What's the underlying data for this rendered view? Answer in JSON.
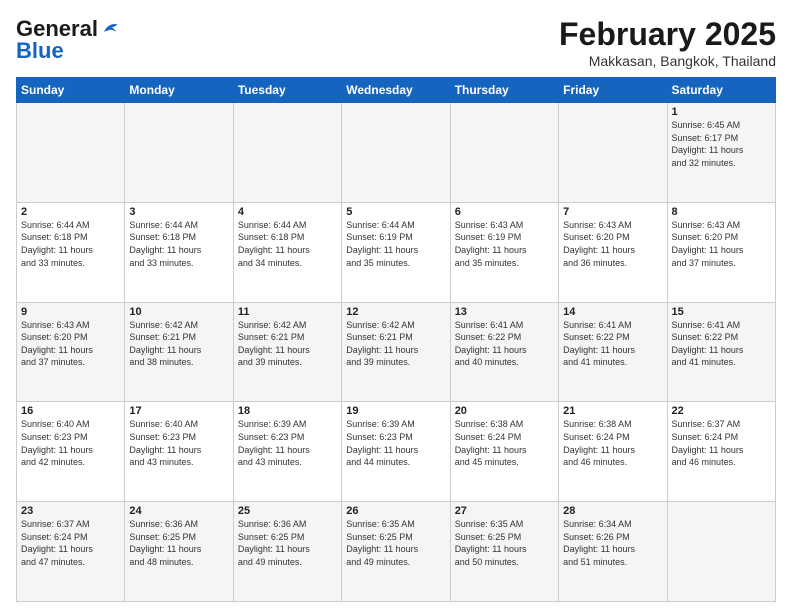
{
  "logo": {
    "line1": "General",
    "line2": "Blue"
  },
  "title": "February 2025",
  "location": "Makkasan, Bangkok, Thailand",
  "days_of_week": [
    "Sunday",
    "Monday",
    "Tuesday",
    "Wednesday",
    "Thursday",
    "Friday",
    "Saturday"
  ],
  "weeks": [
    [
      {
        "day": "",
        "info": ""
      },
      {
        "day": "",
        "info": ""
      },
      {
        "day": "",
        "info": ""
      },
      {
        "day": "",
        "info": ""
      },
      {
        "day": "",
        "info": ""
      },
      {
        "day": "",
        "info": ""
      },
      {
        "day": "1",
        "info": "Sunrise: 6:45 AM\nSunset: 6:17 PM\nDaylight: 11 hours\nand 32 minutes."
      }
    ],
    [
      {
        "day": "2",
        "info": "Sunrise: 6:44 AM\nSunset: 6:18 PM\nDaylight: 11 hours\nand 33 minutes."
      },
      {
        "day": "3",
        "info": "Sunrise: 6:44 AM\nSunset: 6:18 PM\nDaylight: 11 hours\nand 33 minutes."
      },
      {
        "day": "4",
        "info": "Sunrise: 6:44 AM\nSunset: 6:18 PM\nDaylight: 11 hours\nand 34 minutes."
      },
      {
        "day": "5",
        "info": "Sunrise: 6:44 AM\nSunset: 6:19 PM\nDaylight: 11 hours\nand 35 minutes."
      },
      {
        "day": "6",
        "info": "Sunrise: 6:43 AM\nSunset: 6:19 PM\nDaylight: 11 hours\nand 35 minutes."
      },
      {
        "day": "7",
        "info": "Sunrise: 6:43 AM\nSunset: 6:20 PM\nDaylight: 11 hours\nand 36 minutes."
      },
      {
        "day": "8",
        "info": "Sunrise: 6:43 AM\nSunset: 6:20 PM\nDaylight: 11 hours\nand 37 minutes."
      }
    ],
    [
      {
        "day": "9",
        "info": "Sunrise: 6:43 AM\nSunset: 6:20 PM\nDaylight: 11 hours\nand 37 minutes."
      },
      {
        "day": "10",
        "info": "Sunrise: 6:42 AM\nSunset: 6:21 PM\nDaylight: 11 hours\nand 38 minutes."
      },
      {
        "day": "11",
        "info": "Sunrise: 6:42 AM\nSunset: 6:21 PM\nDaylight: 11 hours\nand 39 minutes."
      },
      {
        "day": "12",
        "info": "Sunrise: 6:42 AM\nSunset: 6:21 PM\nDaylight: 11 hours\nand 39 minutes."
      },
      {
        "day": "13",
        "info": "Sunrise: 6:41 AM\nSunset: 6:22 PM\nDaylight: 11 hours\nand 40 minutes."
      },
      {
        "day": "14",
        "info": "Sunrise: 6:41 AM\nSunset: 6:22 PM\nDaylight: 11 hours\nand 41 minutes."
      },
      {
        "day": "15",
        "info": "Sunrise: 6:41 AM\nSunset: 6:22 PM\nDaylight: 11 hours\nand 41 minutes."
      }
    ],
    [
      {
        "day": "16",
        "info": "Sunrise: 6:40 AM\nSunset: 6:23 PM\nDaylight: 11 hours\nand 42 minutes."
      },
      {
        "day": "17",
        "info": "Sunrise: 6:40 AM\nSunset: 6:23 PM\nDaylight: 11 hours\nand 43 minutes."
      },
      {
        "day": "18",
        "info": "Sunrise: 6:39 AM\nSunset: 6:23 PM\nDaylight: 11 hours\nand 43 minutes."
      },
      {
        "day": "19",
        "info": "Sunrise: 6:39 AM\nSunset: 6:23 PM\nDaylight: 11 hours\nand 44 minutes."
      },
      {
        "day": "20",
        "info": "Sunrise: 6:38 AM\nSunset: 6:24 PM\nDaylight: 11 hours\nand 45 minutes."
      },
      {
        "day": "21",
        "info": "Sunrise: 6:38 AM\nSunset: 6:24 PM\nDaylight: 11 hours\nand 46 minutes."
      },
      {
        "day": "22",
        "info": "Sunrise: 6:37 AM\nSunset: 6:24 PM\nDaylight: 11 hours\nand 46 minutes."
      }
    ],
    [
      {
        "day": "23",
        "info": "Sunrise: 6:37 AM\nSunset: 6:24 PM\nDaylight: 11 hours\nand 47 minutes."
      },
      {
        "day": "24",
        "info": "Sunrise: 6:36 AM\nSunset: 6:25 PM\nDaylight: 11 hours\nand 48 minutes."
      },
      {
        "day": "25",
        "info": "Sunrise: 6:36 AM\nSunset: 6:25 PM\nDaylight: 11 hours\nand 49 minutes."
      },
      {
        "day": "26",
        "info": "Sunrise: 6:35 AM\nSunset: 6:25 PM\nDaylight: 11 hours\nand 49 minutes."
      },
      {
        "day": "27",
        "info": "Sunrise: 6:35 AM\nSunset: 6:25 PM\nDaylight: 11 hours\nand 50 minutes."
      },
      {
        "day": "28",
        "info": "Sunrise: 6:34 AM\nSunset: 6:26 PM\nDaylight: 11 hours\nand 51 minutes."
      },
      {
        "day": "",
        "info": ""
      }
    ]
  ]
}
